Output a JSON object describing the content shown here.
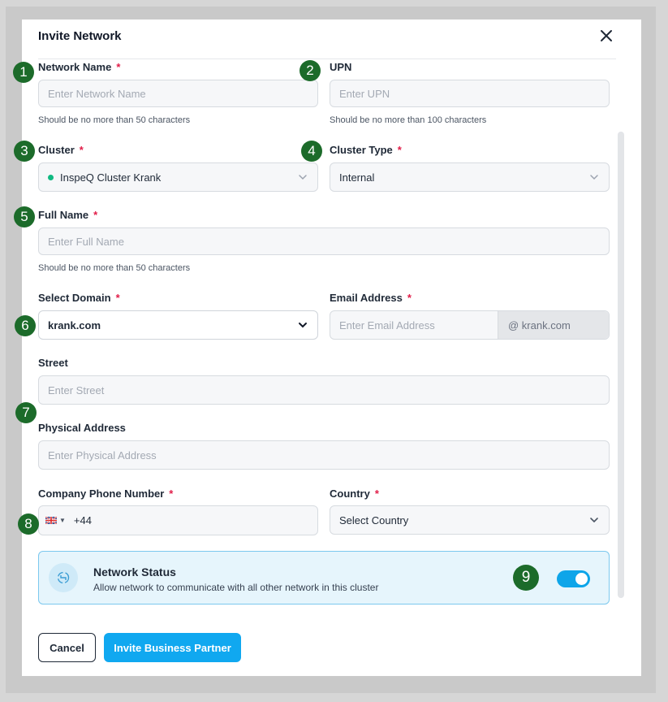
{
  "modal": {
    "title": "Invite Network"
  },
  "fields": {
    "network_name": {
      "label": "Network Name",
      "required": "*",
      "placeholder": "Enter Network Name",
      "hint": "Should be no more than 50 characters"
    },
    "upn": {
      "label": "UPN",
      "placeholder": "Enter UPN",
      "hint": "Should be no more than 100 characters"
    },
    "cluster": {
      "label": "Cluster",
      "required": "*",
      "value": "InspeQ Cluster Krank"
    },
    "cluster_type": {
      "label": "Cluster Type",
      "required": "*",
      "value": "Internal"
    },
    "full_name": {
      "label": "Full Name",
      "required": "*",
      "placeholder": "Enter Full Name",
      "hint": "Should be no more than 50 characters"
    },
    "domain": {
      "label": "Select Domain",
      "required": "*",
      "value": "krank.com"
    },
    "email": {
      "label": "Email Address",
      "required": "*",
      "placeholder": "Enter Email Address",
      "suffix": "@ krank.com"
    },
    "street": {
      "label": "Street",
      "placeholder": "Enter Street"
    },
    "physical_address": {
      "label": "Physical Address",
      "placeholder": "Enter Physical Address"
    },
    "phone": {
      "label": "Company Phone Number",
      "required": "*",
      "value": "+44"
    },
    "country": {
      "label": "Country",
      "required": "*",
      "value": "Select Country"
    }
  },
  "network_status": {
    "title": "Network Status",
    "description": "Allow network to communicate with all other network in this cluster",
    "enabled": true
  },
  "buttons": {
    "cancel": "Cancel",
    "invite": "Invite Business Partner"
  },
  "badges": [
    "1",
    "2",
    "3",
    "4",
    "5",
    "6",
    "7",
    "8",
    "9"
  ],
  "colors": {
    "accent": "#10a8f0",
    "badge": "#1c6b2a",
    "required": "#e11d48",
    "status_online": "#10b981"
  }
}
